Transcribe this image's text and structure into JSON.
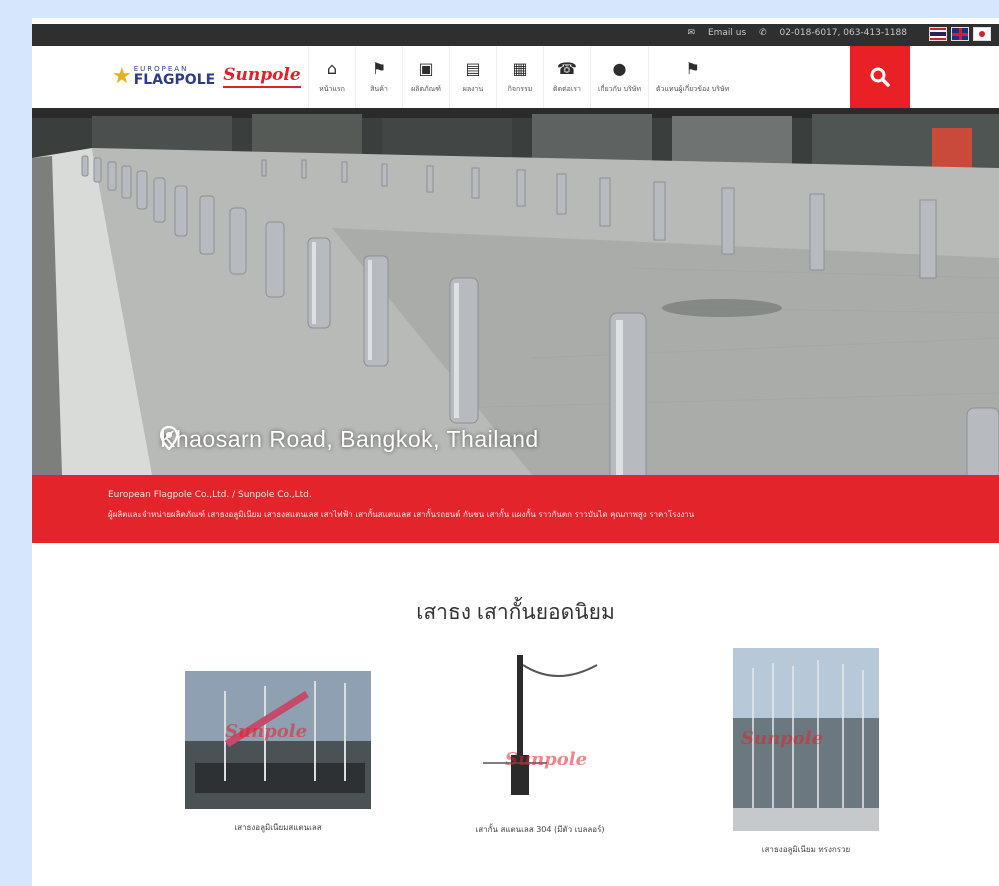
{
  "topbar": {
    "email": "Email us",
    "phone": "02-018-6017, 063-413-1188",
    "languages": [
      "th-flag",
      "uk-flag",
      "jp-flag"
    ]
  },
  "logo": {
    "small": "EUROPEAN",
    "big": "FLAGPOLE",
    "brand": "Sunpole"
  },
  "nav": {
    "items": [
      {
        "icon": "home-icon",
        "glyph": "⌂",
        "label": "หน้าแรก"
      },
      {
        "icon": "flag-icon",
        "glyph": "⚑",
        "label": "สินค้า"
      },
      {
        "icon": "cube-icon",
        "glyph": "▣",
        "label": "ผลิตภัณฑ์"
      },
      {
        "icon": "image-icon",
        "glyph": "▤",
        "label": "ผลงาน"
      },
      {
        "icon": "calendar-icon",
        "glyph": "▦",
        "label": "กิจกรรม"
      },
      {
        "icon": "phone-icon",
        "glyph": "☎",
        "label": "ติดต่อเรา"
      },
      {
        "icon": "user-icon",
        "glyph": "●",
        "label": "เกี่ยวกับ บริษัท"
      },
      {
        "icon": "flag-icon",
        "glyph": "⚑",
        "label": "ตัวแทนผู้เกี่ยวข้อง บริษัท"
      }
    ],
    "search_icon": "search-icon"
  },
  "hero": {
    "caption": "Khaosarn Road, Bangkok, Thailand"
  },
  "banner": {
    "line1": "European Flagpole Co.,Ltd. / Sunpole Co.,Ltd.",
    "line2": "ผู้ผลิตและจำหน่ายผลิตภัณฑ์ เสาธงอลูมิเนียม เสาธงสแตนเลส เสาไฟฟ้า เสากั้นสแตนเลส เสากั้นรถยนต์ กันชน เสากั้น แผงกั้น ราวกันตก ราวบันได คุณภาพสูง ราคาโรงงาน"
  },
  "products": {
    "title": "เสาธง เสากั้นยอดนิยม",
    "items": [
      {
        "caption": "เสาธงอลูมิเนียมสแตนเลส"
      },
      {
        "caption": "เสากั้น สแตนเลส 304 (มีตัว เบลลอร์)"
      },
      {
        "caption": "เสาธงอลูมิเนียม ทรงกรวย"
      }
    ],
    "watermark": "Sunpole"
  },
  "colors": {
    "accent": "#e3252b",
    "topbar": "#2f2f2f"
  }
}
